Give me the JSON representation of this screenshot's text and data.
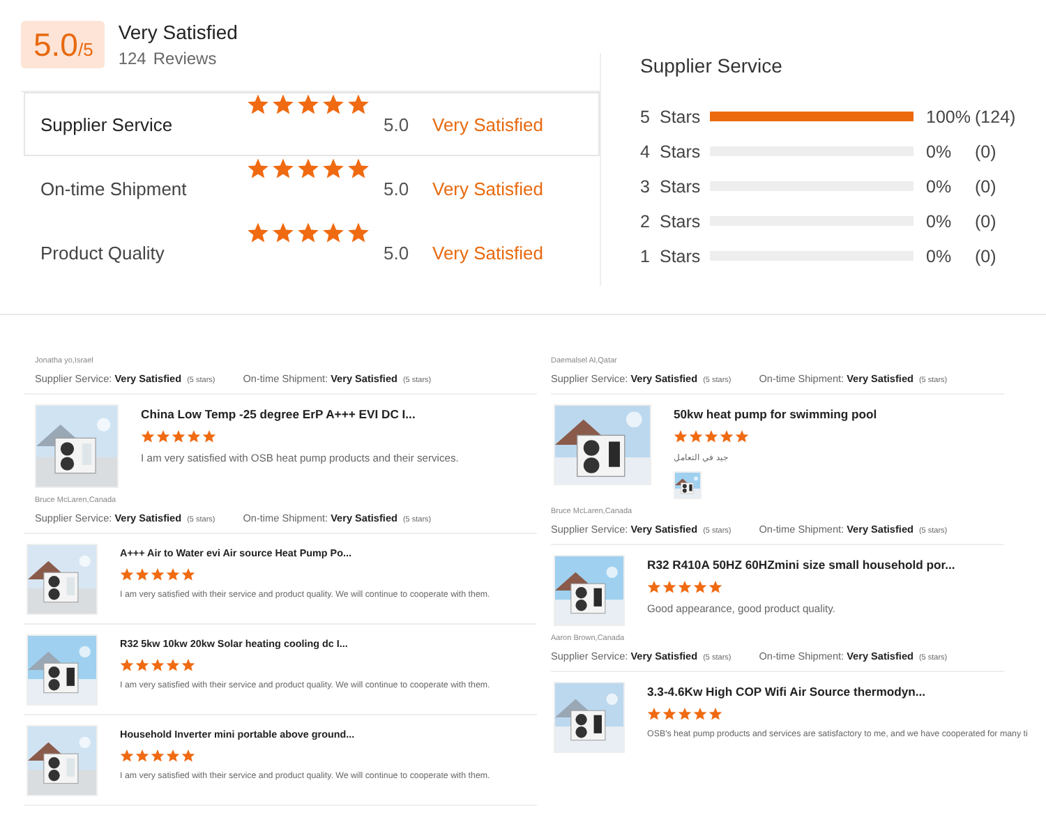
{
  "summary": {
    "score": "5.0",
    "out_of": "/5",
    "verdict": "Very Satisfied",
    "review_count": "124",
    "reviews_label": "Reviews"
  },
  "ratings": [
    {
      "name": "Supplier Service",
      "stars": 5,
      "score": "5.0",
      "verdict": "Very Satisfied",
      "selected": true
    },
    {
      "name": "On-time Shipment",
      "stars": 5,
      "score": "5.0",
      "verdict": "Very Satisfied",
      "selected": false
    },
    {
      "name": "Product Quality",
      "stars": 5,
      "score": "5.0",
      "verdict": "Very Satisfied",
      "selected": false
    }
  ],
  "distribution": {
    "title": "Supplier Service",
    "rows": [
      {
        "number": "5",
        "label": "Stars",
        "level": 1,
        "percent": "100%",
        "count": "(124)"
      },
      {
        "number": "4",
        "label": "Stars",
        "level": 0,
        "percent": "0%",
        "count": "(0)"
      },
      {
        "number": "3",
        "label": "Stars",
        "level": 0,
        "percent": "0%",
        "count": "(0)"
      },
      {
        "number": "2",
        "label": "Stars",
        "level": 0,
        "percent": "0%",
        "count": "(0)"
      },
      {
        "number": "1",
        "label": "Stars",
        "level": 0,
        "percent": "0%",
        "count": "(0)"
      }
    ]
  },
  "columns": [
    {
      "groups": [
        {
          "reviewer": "Jonatha yo,Israel",
          "supplier_label": "Supplier Service:",
          "supplier_value": "Very Satisfied",
          "supplier_stars": "(5 stars)",
          "shipment_label": "On-time Shipment:",
          "shipment_value": "Very Satisfied",
          "shipment_stars": "(5 stars)",
          "products": [
            {
              "title": "China Low Temp -25 degree ErP A+++ EVI DC I...",
              "stars": 5,
              "comment": "I am very satisfied with OSB heat pump products and their services."
            }
          ]
        },
        {
          "reviewer": "Bruce McLaren,Canada",
          "supplier_label": "Supplier Service:",
          "supplier_value": "Very Satisfied",
          "supplier_stars": "(5 stars)",
          "shipment_label": "On-time Shipment:",
          "shipment_value": "Very Satisfied",
          "shipment_stars": "(5 stars)",
          "products": [
            {
              "title": "A+++ Air to Water evi Air source Heat Pump Po...",
              "stars": 5,
              "comment": "I am very satisfied with their service and product quality. We will continue to cooperate with them."
            },
            {
              "title": "R32 5kw 10kw 20kw Solar heating cooling dc I...",
              "stars": 5,
              "comment": "I am very satisfied with their service and product quality. We will continue to cooperate with them."
            },
            {
              "title": "Household Inverter mini portable above ground...",
              "stars": 5,
              "comment": "I am very satisfied with their service and product quality. We will continue to cooperate with them."
            }
          ]
        }
      ]
    },
    {
      "groups": [
        {
          "reviewer": "Daemalsel Al,Qatar",
          "supplier_label": "Supplier Service:",
          "supplier_value": "Very Satisfied",
          "supplier_stars": "(5 stars)",
          "shipment_label": "On-time Shipment:",
          "shipment_value": "Very Satisfied",
          "shipment_stars": "(5 stars)",
          "products": [
            {
              "title": "50kw heat pump for swimming pool",
              "stars": 5,
              "comment": "جيد في التعامل",
              "attachments": [
                {
                  "kind": "picture"
                }
              ]
            }
          ]
        },
        {
          "reviewer": "Bruce McLaren,Canada",
          "supplier_label": "Supplier Service:",
          "supplier_value": "Very Satisfied",
          "supplier_stars": "(5 stars)",
          "shipment_label": "On-time Shipment:",
          "shipment_value": "Very Satisfied",
          "shipment_stars": "(5 stars)",
          "products": [
            {
              "title": "R32 R410A 50HZ 60HZmini size small household por...",
              "stars": 5,
              "comment": "Good appearance, good product quality."
            }
          ]
        },
        {
          "reviewer": "Aaron Brown,Canada",
          "supplier_label": "Supplier Service:",
          "supplier_value": "Very Satisfied",
          "supplier_stars": "(5 stars)",
          "shipment_label": "On-time Shipment:",
          "shipment_value": "Very Satisfied",
          "shipment_stars": "(5 stars)",
          "products": [
            {
              "title": "3.3-4.6Kw High COP Wifi Air Source thermodyn...",
              "stars": 5,
              "comment": "OSB's heat pump products and services are satisfactory to me, and we have cooperated for many ti"
            }
          ]
        }
      ]
    }
  ]
}
